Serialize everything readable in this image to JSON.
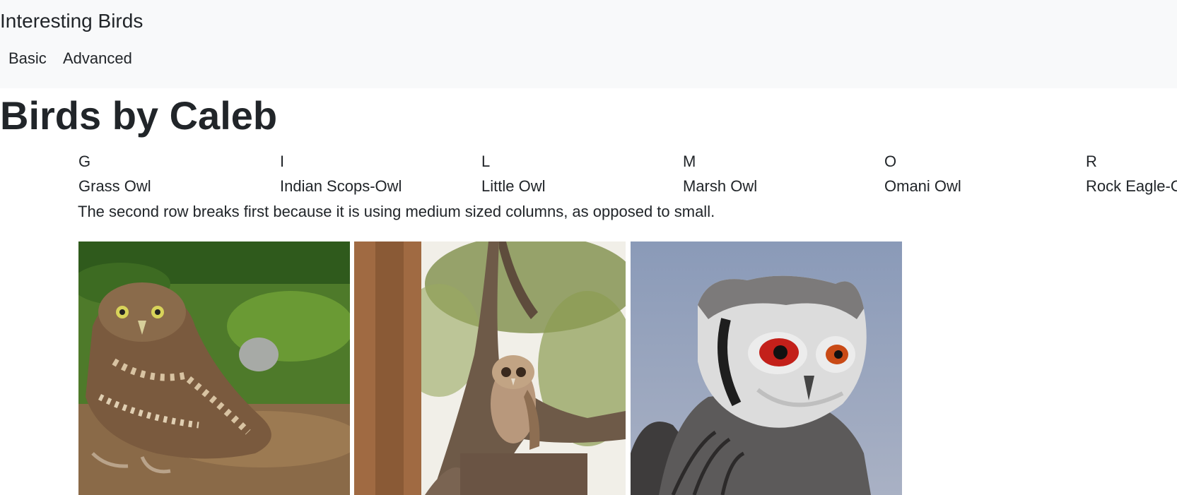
{
  "navbar": {
    "brand": "Interesting Birds",
    "links": [
      "Basic",
      "Advanced"
    ]
  },
  "page_title": "Birds by Caleb",
  "columns": [
    {
      "letter": "G",
      "name": "Grass Owl"
    },
    {
      "letter": "I",
      "name": "Indian Scops-Owl"
    },
    {
      "letter": "L",
      "name": "Little Owl"
    },
    {
      "letter": "M",
      "name": "Marsh Owl"
    },
    {
      "letter": "O",
      "name": "Omani Owl"
    },
    {
      "letter": "R",
      "name": "Rock Eagle-Owl"
    }
  ],
  "note": "The second row breaks first because it is using medium sized columns, as opposed to small.",
  "photos": [
    "burrowing-owl-photo",
    "owl-in-tree-photo",
    "white-faced-scops-owl-photo"
  ]
}
